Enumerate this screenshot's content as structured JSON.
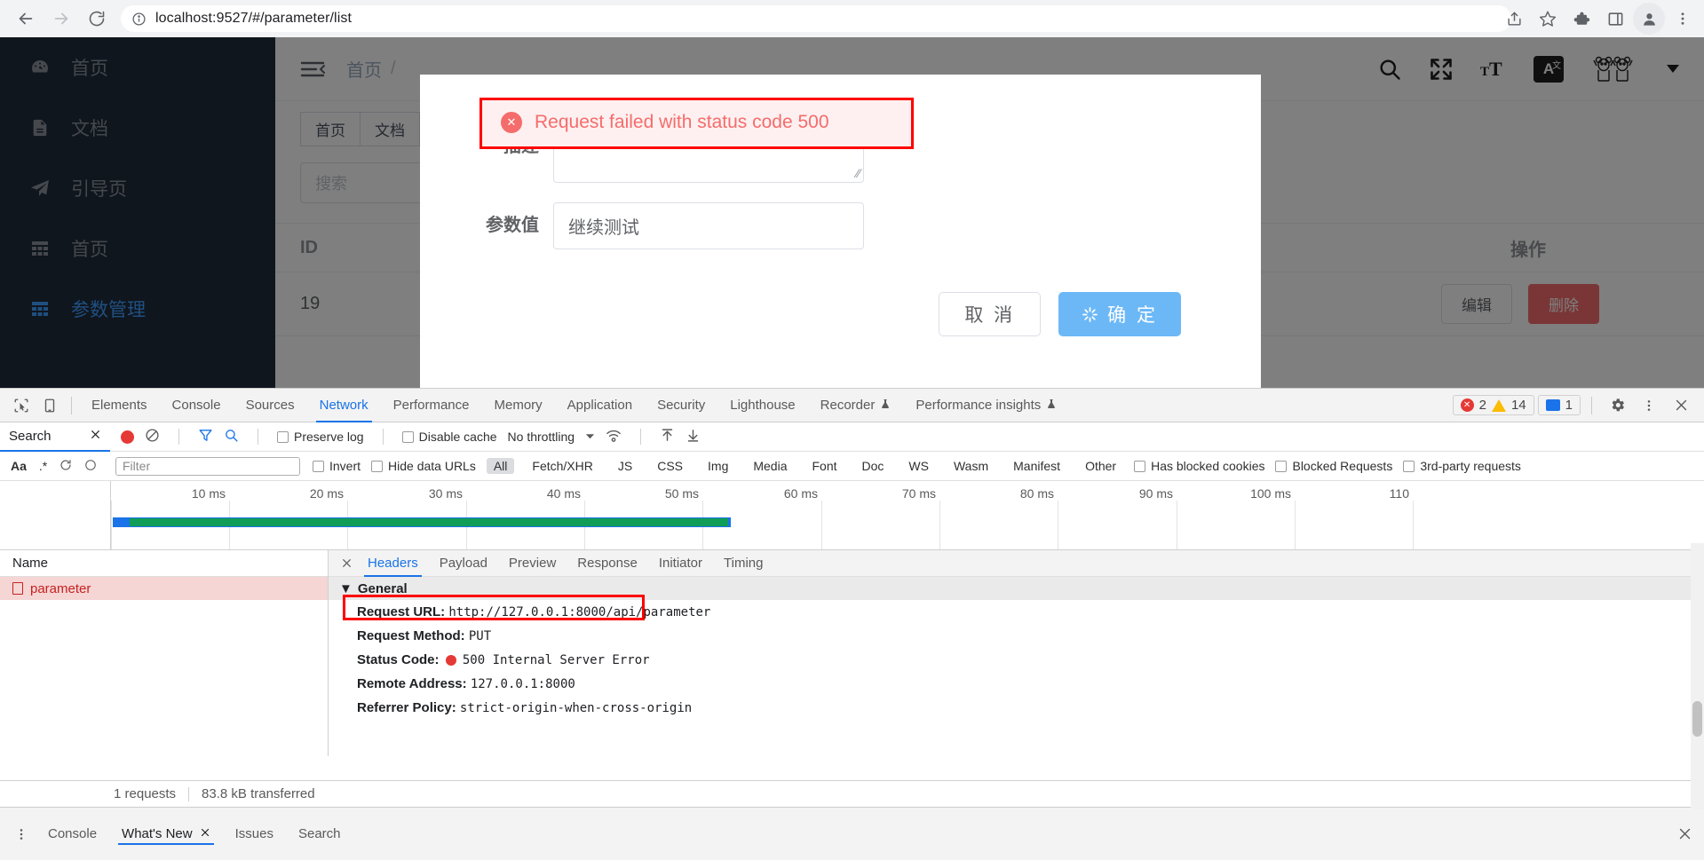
{
  "browser": {
    "back_label": "back-arrow",
    "forward_label": "forward-arrow",
    "reload_label": "reload",
    "url": "localhost:9527/#/parameter/list",
    "url_host": "localhost:9527",
    "url_path": "/#/parameter/list"
  },
  "app": {
    "sidebar": [
      {
        "label": "首页",
        "icon": "dashboard-icon",
        "active": false
      },
      {
        "label": "文档",
        "icon": "document-icon",
        "active": false
      },
      {
        "label": "引导页",
        "icon": "guide-icon",
        "active": false
      },
      {
        "label": "首页",
        "icon": "table-icon",
        "active": false
      },
      {
        "label": "参数管理",
        "icon": "table-icon",
        "active": true
      }
    ],
    "breadcrumb": [
      "首页",
      "/"
    ],
    "header_icons": [
      "search-icon",
      "fullscreen-icon",
      "font-size-icon",
      "translate-icon",
      "avatar-icon",
      "chevron-down-icon"
    ],
    "translate_label": "A",
    "translate_sup": "文",
    "tabs": [
      "首页",
      "文档"
    ],
    "search_placeholder": "搜索",
    "table": {
      "columns": [
        "ID",
        "操作"
      ],
      "rows": [
        {
          "id": "19",
          "edit": "编辑",
          "delete": "删除"
        }
      ]
    }
  },
  "modal": {
    "fields": [
      {
        "label": "描述",
        "value": ""
      },
      {
        "label": "参数值",
        "value": "继续测试"
      }
    ],
    "cancel_label": "取 消",
    "confirm_label": "确 定",
    "confirm_loading": true
  },
  "toast": {
    "message": "Request failed with status code 500",
    "icon": "error-circle-icon",
    "color": "#f56c6c",
    "background": "#fef0f0"
  },
  "devtools": {
    "tabs": [
      {
        "label": "Elements",
        "active": false
      },
      {
        "label": "Console",
        "active": false
      },
      {
        "label": "Sources",
        "active": false
      },
      {
        "label": "Network",
        "active": true
      },
      {
        "label": "Performance",
        "active": false
      },
      {
        "label": "Memory",
        "active": false
      },
      {
        "label": "Application",
        "active": false
      },
      {
        "label": "Security",
        "active": false
      },
      {
        "label": "Lighthouse",
        "active": false
      },
      {
        "label": "Recorder",
        "active": false,
        "experiment": true
      },
      {
        "label": "Performance insights",
        "active": false,
        "experiment": true
      }
    ],
    "error_count": "2",
    "warning_count": "14",
    "message_count": "1",
    "search_panel_label": "Search",
    "network_toolbar": {
      "preserve_log": "Preserve log",
      "disable_cache": "Disable cache",
      "throttling": "No throttling"
    },
    "filter_bar": {
      "case_label": "Aa",
      "regex_label": ".*",
      "filter_placeholder": "Filter",
      "invert": "Invert",
      "hide_data_urls": "Hide data URLs",
      "types": [
        "All",
        "Fetch/XHR",
        "JS",
        "CSS",
        "Img",
        "Media",
        "Font",
        "Doc",
        "WS",
        "Wasm",
        "Manifest",
        "Other"
      ],
      "selected_type": "All",
      "has_blocked_cookies": "Has blocked cookies",
      "blocked_requests": "Blocked Requests",
      "third_party": "3rd-party requests"
    },
    "timeline": {
      "ticks": [
        "10 ms",
        "20 ms",
        "30 ms",
        "40 ms",
        "50 ms",
        "60 ms",
        "70 ms",
        "80 ms",
        "90 ms",
        "100 ms",
        "110"
      ]
    },
    "requests_header": "Name",
    "requests": [
      {
        "name": "parameter",
        "error": true
      }
    ],
    "detail_tabs": [
      {
        "label": "Headers",
        "active": true
      },
      {
        "label": "Payload",
        "active": false
      },
      {
        "label": "Preview",
        "active": false
      },
      {
        "label": "Response",
        "active": false
      },
      {
        "label": "Initiator",
        "active": false
      },
      {
        "label": "Timing",
        "active": false
      }
    ],
    "general_section": "General",
    "general": [
      {
        "key": "Request URL:",
        "value": "http://127.0.0.1:8000/api/parameter",
        "highlight": false
      },
      {
        "key": "Request Method:",
        "value": "PUT",
        "highlight": false
      },
      {
        "key": "Status Code:",
        "value": "500 Internal Server Error",
        "highlight": true,
        "dot": true
      },
      {
        "key": "Remote Address:",
        "value": "127.0.0.1:8000",
        "highlight": false
      },
      {
        "key": "Referrer Policy:",
        "value": "strict-origin-when-cross-origin",
        "highlight": false
      }
    ],
    "status_bar": {
      "requests": "1 requests",
      "transferred": "83.8 kB transferred"
    },
    "drawer_tabs": [
      {
        "label": "Console",
        "active": false,
        "closable": false
      },
      {
        "label": "What's New",
        "active": true,
        "closable": true
      },
      {
        "label": "Issues",
        "active": false,
        "closable": false
      },
      {
        "label": "Search",
        "active": false,
        "closable": false
      }
    ]
  }
}
